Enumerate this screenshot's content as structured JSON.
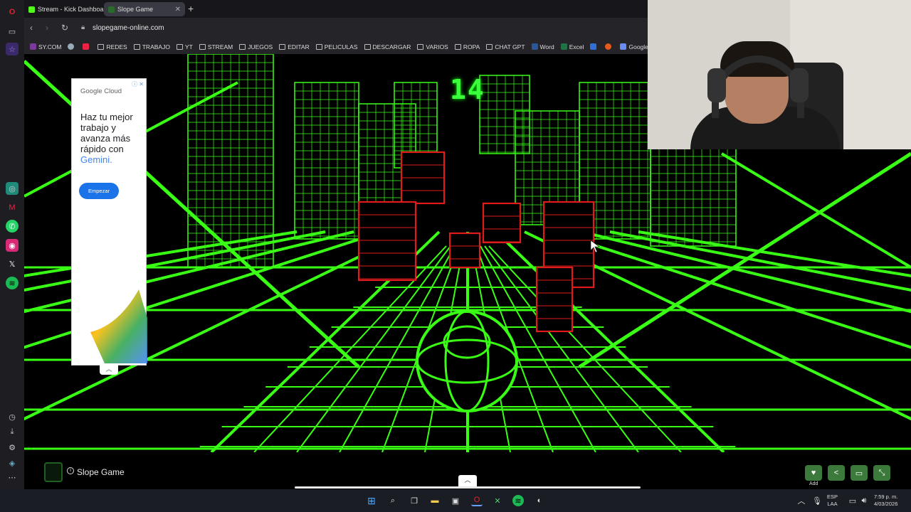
{
  "browser": {
    "tabs": [
      {
        "label": "Stream - Kick Dashboard",
        "color": "#53fc18",
        "active": false
      },
      {
        "label": "Slope Game",
        "color": "#2a6a2a",
        "active": true
      }
    ],
    "url": "slopegame-online.com",
    "bookmarks": [
      "SY.COM",
      "REDES",
      "TRABAJO",
      "YT",
      "STREAM",
      "JUEGOS",
      "EDITAR",
      "PELICULAS",
      "DESCARGAR",
      "VARIOS",
      "ROPA",
      "CHAT GPT",
      "Word",
      "Excel",
      "Google Gemini"
    ]
  },
  "game": {
    "score": "14",
    "name": "Slope Game",
    "accent": "#39ff14",
    "obstacle_color": "#e01b1b"
  },
  "ad": {
    "brand": "Google Cloud",
    "headline": "Haz tu mejor trabajo y avanza más rápido con",
    "highlight": "Gemini.",
    "cta": "Empezar",
    "info": "ⓘ ✕"
  },
  "footer": {
    "add_label": "Add"
  },
  "taskbar": {
    "lang": "ESP",
    "region": "LAA",
    "time": "7:59 p. m.",
    "date": "4/03/2026"
  }
}
